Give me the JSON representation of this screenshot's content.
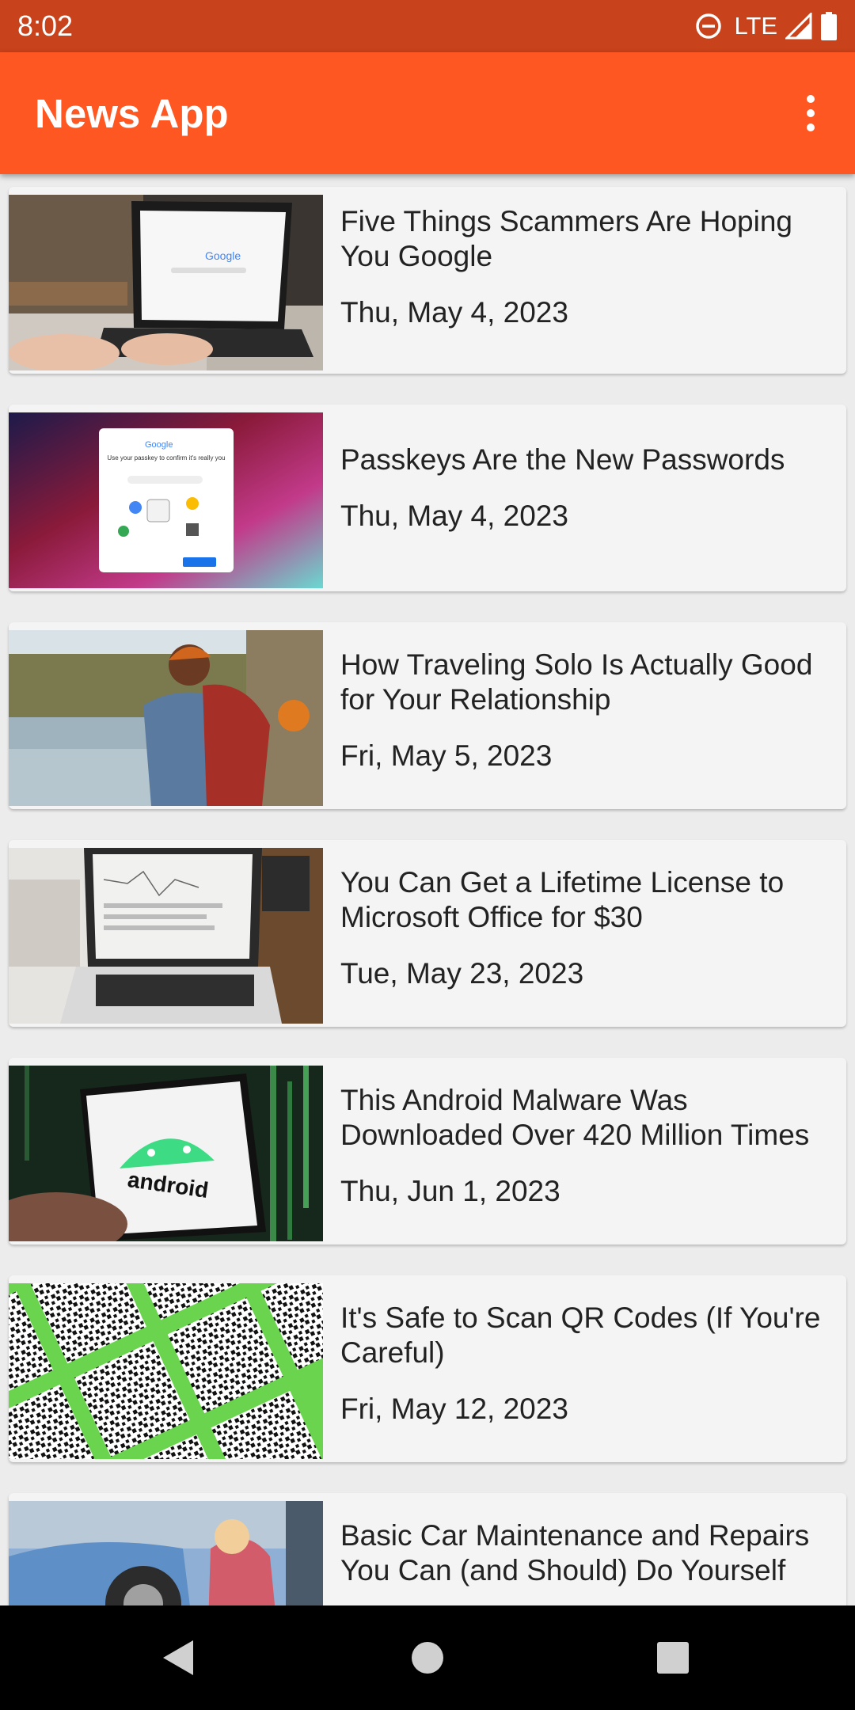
{
  "status_bar": {
    "time": "8:02",
    "network": "LTE",
    "icons": [
      "do-not-disturb-icon",
      "signal-icon",
      "battery-icon"
    ]
  },
  "app_bar": {
    "title": "News App",
    "menu_icon": "more-vert-icon"
  },
  "colors": {
    "status_bar": "#c8421b",
    "app_bar": "#fe5722",
    "card": "#f4f4f4",
    "background": "#ececec",
    "nav_bar": "#000000"
  },
  "articles": [
    {
      "title": "Five Things Scammers Are Hoping You Google",
      "date": "Thu, May 4, 2023"
    },
    {
      "title": "Passkeys Are the New Passwords",
      "date": "Thu, May 4, 2023"
    },
    {
      "title": "How Traveling Solo Is Actually Good for Your Relationship",
      "date": "Fri, May 5, 2023"
    },
    {
      "title": "You Can Get a Lifetime License to Microsoft Office for $30",
      "date": "Tue, May 23, 2023"
    },
    {
      "title": "This Android Malware Was Downloaded Over 420 Million Times",
      "date": "Thu, Jun 1, 2023"
    },
    {
      "title": "It's Safe to Scan QR Codes (If You're Careful)",
      "date": "Fri, May 12, 2023"
    },
    {
      "title": "Basic Car Maintenance and Repairs You Can (and Should) Do Yourself",
      "date": ""
    }
  ],
  "thumbnail_texts": {
    "google_logo": "Google",
    "passkey_prompt": "Use your passkey to confirm it's really you",
    "android_logo": "android"
  },
  "nav_bar": {
    "icons": [
      "back-icon",
      "home-icon",
      "recents-icon"
    ]
  }
}
